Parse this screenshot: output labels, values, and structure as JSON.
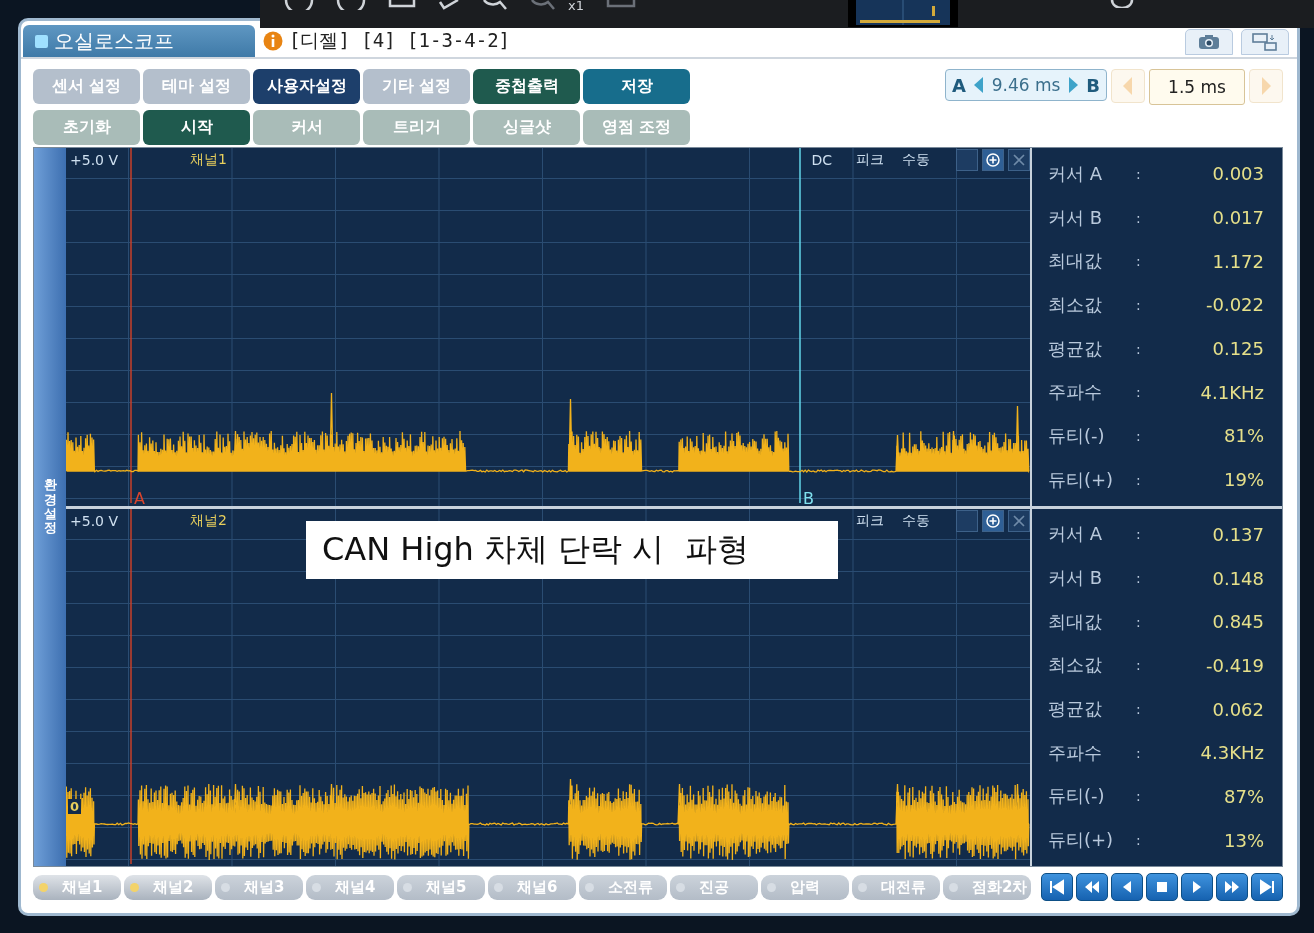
{
  "toolbar": {
    "zoom_label": "x1"
  },
  "window": {
    "title": "오실로스코프",
    "info": "[디젤] [4] [1-3-4-2]"
  },
  "buttons": [
    {
      "label": "센서 설정",
      "color": "#b4bfcc"
    },
    {
      "label": "테마 설정",
      "color": "#b4bfcc"
    },
    {
      "label": "사용자설정",
      "color": "#1d3f6b"
    },
    {
      "label": "기타 설정",
      "color": "#b4bfcc"
    },
    {
      "label": "중첩출력",
      "color": "#1f5a4e"
    },
    {
      "label": "저장",
      "color": "#176d8c"
    },
    {
      "label": "초기화",
      "color": "#a9bcb8"
    },
    {
      "label": "시작",
      "color": "#1f5a4e"
    },
    {
      "label": "커서",
      "color": "#a9bcb8"
    },
    {
      "label": "트리거",
      "color": "#a9bcb8"
    },
    {
      "label": "싱글샷",
      "color": "#a9bcb8"
    },
    {
      "label": "영점 조정",
      "color": "#a9bcb8"
    }
  ],
  "cursor_span": {
    "a": "A",
    "value": "9.46 ms",
    "b": "B"
  },
  "time_div": {
    "value": "1.5 ms"
  },
  "sidebar": {
    "label": "환경설정"
  },
  "channels": [
    {
      "scale": "+5.0 V",
      "name": "채널1",
      "coupling": "DC",
      "mode": "피크",
      "range": "수동",
      "cursor_a": "A",
      "cursor_b": "B",
      "stats": [
        {
          "label": "커서 A",
          "sep": ":",
          "value": "0.003"
        },
        {
          "label": "커서 B",
          "sep": ":",
          "value": "0.017"
        },
        {
          "label": "최대값",
          "sep": ":",
          "value": "1.172"
        },
        {
          "label": "최소값",
          "sep": ":",
          "value": "-0.022"
        },
        {
          "label": "평균값",
          "sep": ":",
          "value": "0.125"
        },
        {
          "label": "주파수",
          "sep": ":",
          "value": "4.1KHz"
        },
        {
          "label": "듀티(-)",
          "sep": ":",
          "value": "81%"
        },
        {
          "label": "듀티(+)",
          "sep": ":",
          "value": "19%"
        }
      ]
    },
    {
      "scale": "+5.0 V",
      "name": "채널2",
      "ground": "0",
      "range": "수동",
      "mode": "피크",
      "stats": [
        {
          "label": "커서 A",
          "sep": ":",
          "value": "0.137"
        },
        {
          "label": "커서 B",
          "sep": ":",
          "value": "0.148"
        },
        {
          "label": "최대값",
          "sep": ":",
          "value": "0.845"
        },
        {
          "label": "최소값",
          "sep": ":",
          "value": "-0.419"
        },
        {
          "label": "평균값",
          "sep": ":",
          "value": "0.062"
        },
        {
          "label": "주파수",
          "sep": ":",
          "value": "4.3KHz"
        },
        {
          "label": "듀티(-)",
          "sep": ":",
          "value": "87%"
        },
        {
          "label": "듀티(+)",
          "sep": ":",
          "value": "13%"
        }
      ]
    }
  ],
  "caption": "CAN High 차체 단락 시  파형",
  "channel_tabs": [
    {
      "label": "채널1",
      "on": true
    },
    {
      "label": "채널2",
      "on": true
    },
    {
      "label": "채널3",
      "on": false
    },
    {
      "label": "채널4",
      "on": false
    },
    {
      "label": "채널5",
      "on": false
    },
    {
      "label": "채널6",
      "on": false
    },
    {
      "label": "소전류",
      "on": false
    },
    {
      "label": "진공",
      "on": false
    },
    {
      "label": "압력",
      "on": false
    },
    {
      "label": "대전류",
      "on": false
    },
    {
      "label": "점화2차",
      "on": false
    }
  ]
}
